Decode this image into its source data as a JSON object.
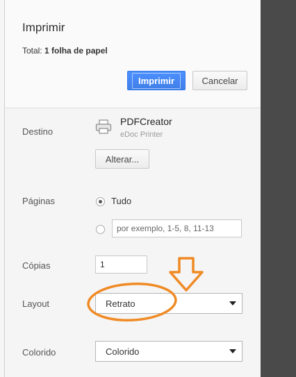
{
  "dialog": {
    "title": "Imprimir",
    "total_label": "Total:",
    "total_value": "1 folha de papel",
    "print_button": "Imprimir",
    "cancel_button": "Cancelar"
  },
  "destination": {
    "label": "Destino",
    "printer_name": "PDFCreator",
    "printer_sub": "eDoc Printer",
    "change_button": "Alterar..."
  },
  "pages": {
    "label": "Páginas",
    "option_all": "Tudo",
    "custom_placeholder": "por exemplo, 1-5, 8, 11-13"
  },
  "copies": {
    "label": "Cópias",
    "value": "1"
  },
  "layout": {
    "label": "Layout",
    "selected": "Retrato"
  },
  "color": {
    "label": "Colorido",
    "selected": "Colorido"
  },
  "annotation_color": "#f08a24"
}
